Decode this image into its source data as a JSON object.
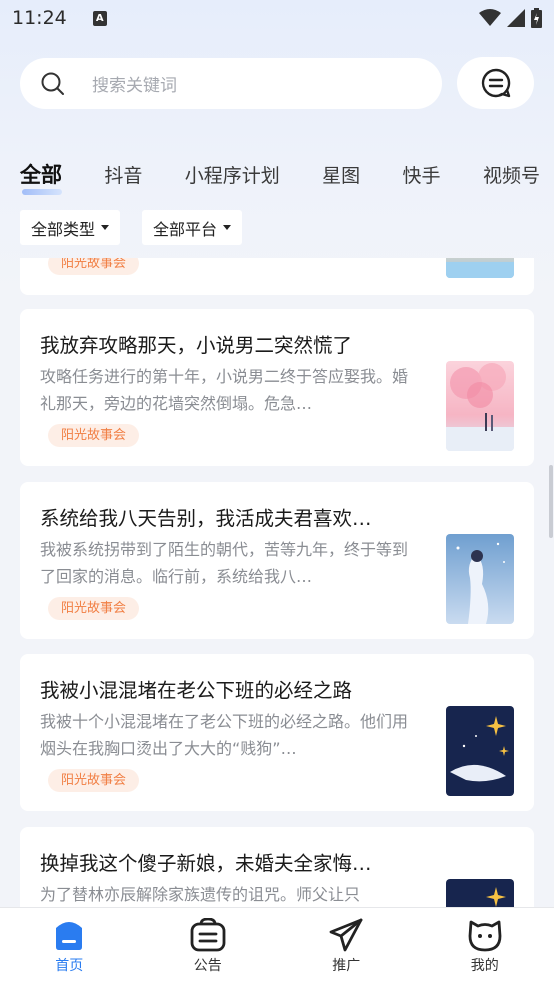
{
  "status_bar": {
    "time": "11:24",
    "notification_letter": "A"
  },
  "search": {
    "placeholder": "搜索关键词"
  },
  "tabs": [
    "全部",
    "抖音",
    "小程序计划",
    "星图",
    "快手",
    "视频号"
  ],
  "filters": {
    "type": "全部类型",
    "platform": "全部平台"
  },
  "cards": [
    {
      "title": "",
      "summary": "",
      "tag": "阳光故事会"
    },
    {
      "title": "我放弃攻略那天，小说男二突然慌了",
      "summary": "攻略任务进行的第十年，小说男二终于答应娶我。婚礼那天，旁边的花墙突然倒塌。危急…",
      "tag": "阳光故事会"
    },
    {
      "title": "系统给我八天告别，我活成夫君喜欢…",
      "summary": "我被系统拐带到了陌生的朝代，苦等九年，终于等到了回家的消息。临行前，系统给我八…",
      "tag": "阳光故事会"
    },
    {
      "title": "我被小混混堵在老公下班的必经之路",
      "summary": "我被十个小混混堵在了老公下班的必经之路。他们用烟头在我胸口烫出了大大的“贱狗”…",
      "tag": "阳光故事会"
    },
    {
      "title": "换掉我这个傻子新娘，未婚夫全家悔…",
      "summary": "为了替林亦辰解除家族遗传的诅咒。师父让只",
      "tag": ""
    }
  ],
  "bottom_nav": [
    {
      "label": "首页",
      "icon": "home-icon",
      "active": true
    },
    {
      "label": "公告",
      "icon": "announcement-icon",
      "active": false
    },
    {
      "label": "推广",
      "icon": "promote-icon",
      "active": false
    },
    {
      "label": "我的",
      "icon": "profile-icon",
      "active": false
    }
  ],
  "colors": {
    "accent": "#2a7cf0",
    "tag_bg": "#fdeee6",
    "tag_text": "#f17f44"
  }
}
